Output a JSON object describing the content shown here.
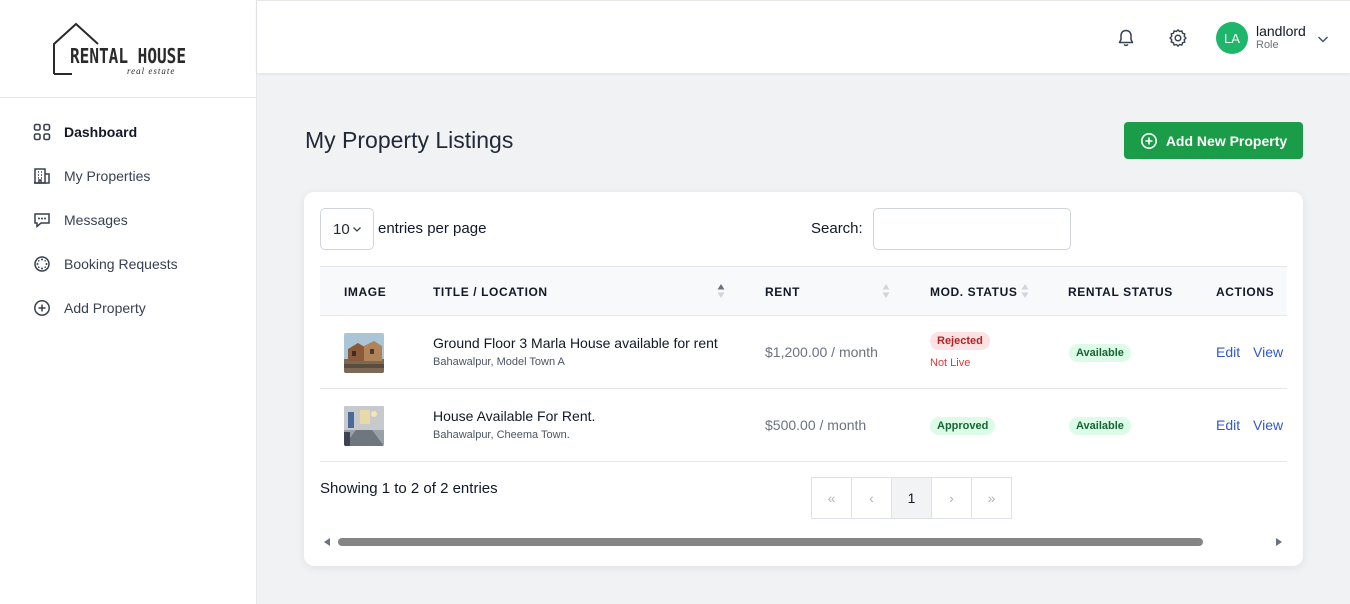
{
  "brand": {
    "name": "RENTAL HOUSE",
    "tagline": "real estate"
  },
  "sidebar": {
    "items": [
      {
        "label": "Dashboard",
        "icon": "grid-icon",
        "active": true
      },
      {
        "label": "My Properties",
        "icon": "building-icon"
      },
      {
        "label": "Messages",
        "icon": "chat-icon"
      },
      {
        "label": "Booking Requests",
        "icon": "spinner-icon"
      },
      {
        "label": "Add Property",
        "icon": "plus-circle-icon"
      }
    ]
  },
  "topbar": {
    "user": {
      "initials": "LA",
      "name": "landlord",
      "role": "Role"
    },
    "icons": [
      "bell-icon",
      "gear-icon",
      "chevron-down-icon"
    ]
  },
  "page": {
    "title": "My Property Listings",
    "add_button": "Add New Property"
  },
  "table_controls": {
    "length_value": "10",
    "length_label": "entries per page",
    "search_label": "Search:",
    "search_value": ""
  },
  "table": {
    "columns": [
      "IMAGE",
      "TITLE / LOCATION",
      "RENT",
      "MOD. STATUS",
      "RENTAL STATUS",
      "ACTIONS"
    ],
    "rows": [
      {
        "title": "Ground Floor 3 Marla House available for rent",
        "location": "Bahawalpur, Model Town A",
        "rent": "$1,200.00 / month",
        "mod_status": "Rejected",
        "mod_note": "Not Live",
        "rental_status": "Available",
        "edit": "Edit",
        "view": "View"
      },
      {
        "title": "House Available For Rent.",
        "location": "Bahawalpur, Cheema Town.",
        "rent": "$500.00 / month",
        "mod_status": "Approved",
        "rental_status": "Available",
        "edit": "Edit",
        "view": "View"
      }
    ]
  },
  "footer": {
    "showing": "Showing 1 to 2 of 2 entries",
    "pager": {
      "first": "«",
      "prev": "‹",
      "current": "1",
      "next": "›",
      "last": "»"
    }
  },
  "colors": {
    "accent_green": "#1a9c48",
    "avatar": "#1eb66a",
    "link": "#3358c8"
  }
}
